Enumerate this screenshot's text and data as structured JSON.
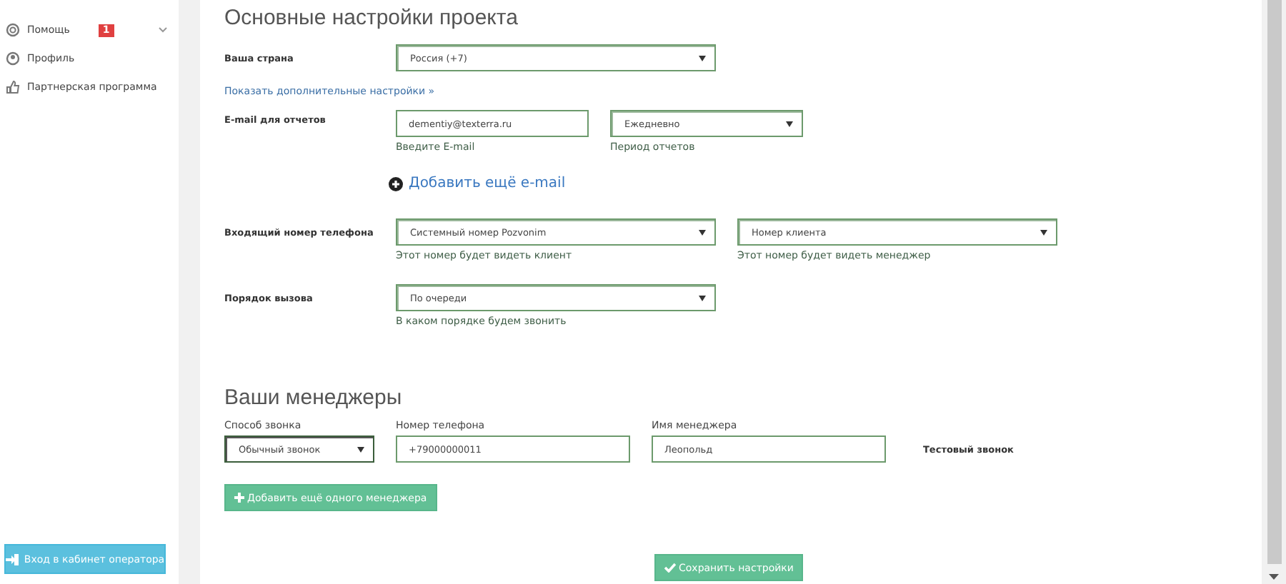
{
  "sidebar": {
    "items": [
      {
        "label": "Помощь",
        "badge": "1",
        "expandable": true
      },
      {
        "label": "Профиль",
        "expandable": false
      },
      {
        "label": "Партнерская программа",
        "expandable": false
      }
    ],
    "operator_button": "Вход в кабинет оператора"
  },
  "settings": {
    "title": "Основные настройки проекта",
    "country": {
      "label": "Ваша страна",
      "value": "Россия (+7)"
    },
    "more_link": "Показать дополнительные настройки »",
    "email": {
      "label": "E-mail для отчетов",
      "value": "dementiy@texterra.ru",
      "hint": "Введите E-mail",
      "period": {
        "value": "Ежедневно",
        "hint": "Период отчетов"
      }
    },
    "add_email": "Добавить ещё e-mail",
    "incoming": {
      "label": "Входящий номер телефона",
      "value": "Системный номер Pozvonim",
      "hint": "Этот номер будет видеть клиент",
      "manager_select": {
        "value": "Номер клиента",
        "hint": "Этот номер будет видеть менеджер"
      }
    },
    "order": {
      "label": "Порядок вызова",
      "value": "По очереди",
      "hint": "В каком порядке будем звонить"
    }
  },
  "managers": {
    "title": "Ваши менеджеры",
    "columns": [
      "Способ звонка",
      "Номер телефона",
      "Имя менеджера"
    ],
    "rows": [
      {
        "method": "Обычный звонок",
        "phone": "+79000000011",
        "name": "Леопольд",
        "test_call": "Тестовый звонок"
      }
    ],
    "add_button": "Добавить ещё одного менеджера"
  },
  "save_button": "Сохранить настройки"
}
